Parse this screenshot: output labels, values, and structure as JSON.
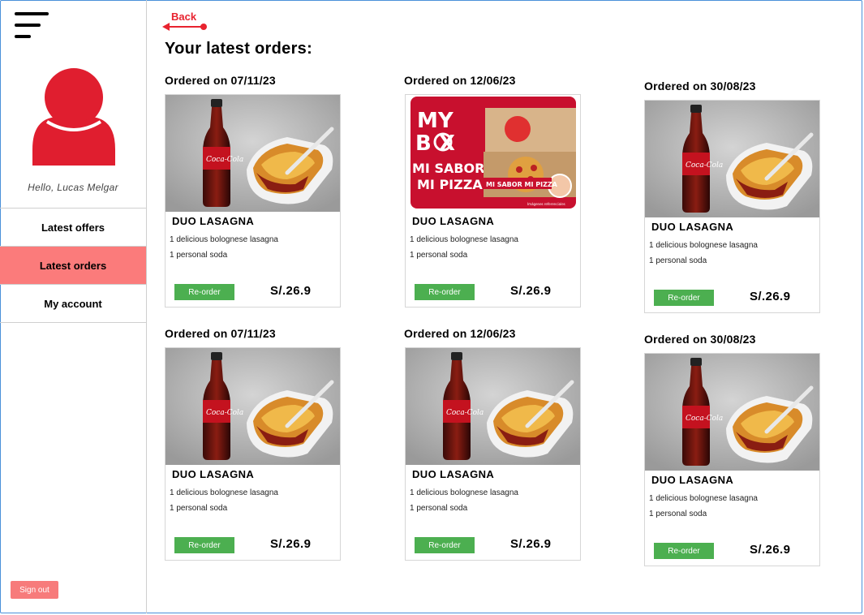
{
  "sidebar": {
    "greeting": "Hello, Lucas Melgar",
    "nav": [
      "Latest offers",
      "Latest orders",
      "My account"
    ],
    "active_index": 1,
    "sign_out": "Sign out"
  },
  "header": {
    "back_label": "Back",
    "title": "Your latest orders:"
  },
  "colors": {
    "accent_red": "#e8232f",
    "active_nav": "#fb7b7b",
    "reorder_green": "#4caf50"
  },
  "orders": [
    {
      "date_label": "Ordered on 07/11/23",
      "image": "lasagna-soda-photo",
      "name": "DUO LASAGNA",
      "line1": "1 delicious bolognese lasagna",
      "line2": "1 personal soda",
      "reorder": "Re-order",
      "price": "S/.26.9"
    },
    {
      "date_label": "Ordered on 12/06/23",
      "image": "pizza-hut-mybox-promo",
      "name": "DUO LASAGNA",
      "line1": "1 delicious bolognese lasagna",
      "line2": "1 personal soda",
      "reorder": "Re-order",
      "price": "S/.26.9",
      "promo": {
        "line_a": "MY",
        "line_b": "B  X",
        "line_c": "MI SABOR",
        "line_d": "MI PIZZA",
        "tag": "MI SABOR MI PIZZA",
        "fine_print": "Imágenes referenciales"
      }
    },
    {
      "date_label": "Ordered on 30/08/23",
      "image": "lasagna-soda-photo",
      "name": "DUO LASAGNA",
      "line1": "1 delicious bolognese lasagna",
      "line2": "1 personal soda",
      "reorder": "Re-order",
      "price": "S/.26.9"
    },
    {
      "date_label": "Ordered on 07/11/23",
      "image": "lasagna-soda-photo",
      "name": "DUO LASAGNA",
      "line1": "1 delicious bolognese lasagna",
      "line2": "1 personal soda",
      "reorder": "Re-order",
      "price": "S/.26.9"
    },
    {
      "date_label": "Ordered on 12/06/23",
      "image": "lasagna-soda-photo",
      "name": "DUO LASAGNA",
      "line1": "1 delicious bolognese lasagna",
      "line2": "1 personal soda",
      "reorder": "Re-order",
      "price": "S/.26.9"
    },
    {
      "date_label": "Ordered on 30/08/23",
      "image": "lasagna-soda-photo",
      "name": "DUO LASAGNA",
      "line1": "1 delicious bolognese lasagna",
      "line2": "1 personal soda",
      "reorder": "Re-order",
      "price": "S/.26.9"
    }
  ]
}
